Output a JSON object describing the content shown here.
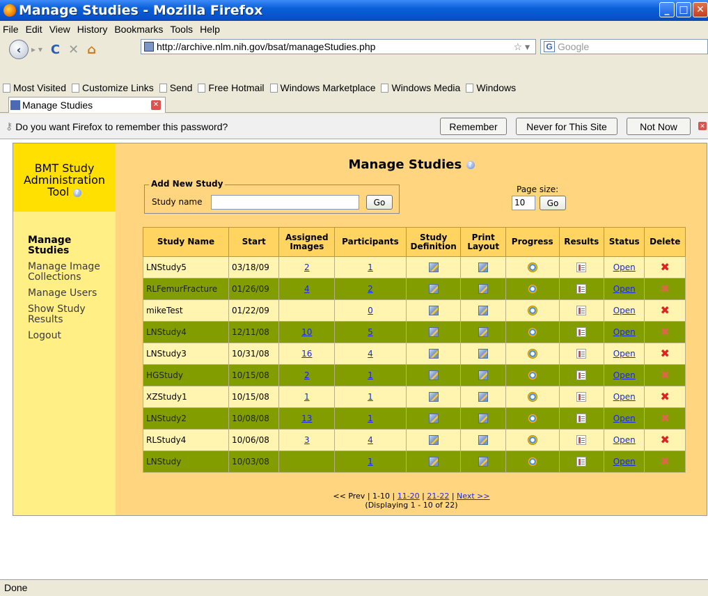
{
  "window": {
    "title": "Manage Studies - Mozilla Firefox"
  },
  "menu": [
    "File",
    "Edit",
    "View",
    "History",
    "Bookmarks",
    "Tools",
    "Help"
  ],
  "nav": {
    "url": "http://archive.nlm.nih.gov/bsat/manageStudies.php",
    "search_placeholder": "Google"
  },
  "bookmarks": [
    "Most Visited",
    "Customize Links",
    "Send",
    "Free Hotmail",
    "Windows Marketplace",
    "Windows Media",
    "Windows"
  ],
  "tab": {
    "label": "Manage Studies"
  },
  "password_bar": {
    "message": "Do you want Firefox to remember this password?",
    "remember": "Remember",
    "never": "Never for This Site",
    "not_now": "Not Now"
  },
  "sidebar": {
    "app_title_line1": "BMT Study",
    "app_title_line2": "Administration",
    "app_title_line3": "Tool",
    "items": [
      {
        "label": "Manage Studies",
        "active": true
      },
      {
        "label": "Manage Image Collections",
        "active": false
      },
      {
        "label": "Manage Users",
        "active": false
      },
      {
        "label": "Show Study Results",
        "active": false
      },
      {
        "label": "Logout",
        "active": false
      }
    ]
  },
  "main": {
    "title": "Manage Studies",
    "add_study": {
      "legend": "Add New Study",
      "label": "Study name",
      "value": "",
      "go": "Go"
    },
    "page_size": {
      "label": "Page size:",
      "value": "10",
      "go": "Go"
    },
    "columns": [
      "Study Name",
      "Start",
      "Assigned Images",
      "Participants",
      "Study Definition",
      "Print Layout",
      "Progress",
      "Results",
      "Status",
      "Delete"
    ],
    "rows": [
      {
        "name": "LNStudy5",
        "start": "03/18/09",
        "images": "2",
        "participants": "1",
        "status": "Open"
      },
      {
        "name": "RLFemurFracture",
        "start": "01/26/09",
        "images": "4",
        "participants": "2",
        "status": "Open"
      },
      {
        "name": "mikeTest",
        "start": "01/22/09",
        "images": "",
        "participants": "0",
        "status": "Open"
      },
      {
        "name": "LNStudy4",
        "start": "12/11/08",
        "images": "10",
        "participants": "5",
        "status": "Open"
      },
      {
        "name": "LNStudy3",
        "start": "10/31/08",
        "images": "16",
        "participants": "4",
        "status": "Open"
      },
      {
        "name": "HGStudy",
        "start": "10/15/08",
        "images": "2",
        "participants": "1",
        "status": "Open"
      },
      {
        "name": "XZStudy1",
        "start": "10/15/08",
        "images": "1",
        "participants": "1",
        "status": "Open"
      },
      {
        "name": "LNStudy2",
        "start": "10/08/08",
        "images": "13",
        "participants": "1",
        "status": "Open"
      },
      {
        "name": "RLStudy4",
        "start": "10/06/08",
        "images": "3",
        "participants": "4",
        "status": "Open"
      },
      {
        "name": "LNStudy",
        "start": "10/03/08",
        "images": "",
        "participants": "1",
        "status": "Open"
      }
    ],
    "pager": {
      "prev": "<< Prev",
      "current": "1-10",
      "pages": [
        "11-20",
        "21-22"
      ],
      "next": "Next >>",
      "summary": "(Displaying 1 - 10 of 22)"
    }
  },
  "status_bar": "Done"
}
